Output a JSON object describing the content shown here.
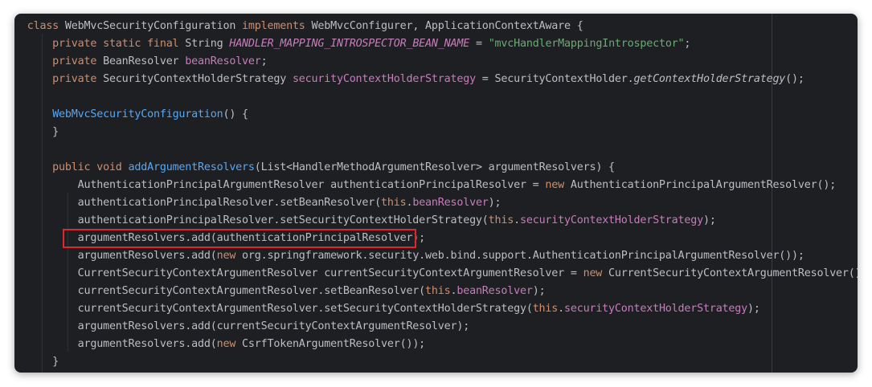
{
  "lines": [
    [
      {
        "t": "class ",
        "c": "kw"
      },
      {
        "t": "WebMvcSecurityConfiguration ",
        "c": "ty"
      },
      {
        "t": "implements ",
        "c": "kw"
      },
      {
        "t": "WebMvcConfigurer, ApplicationContextAware {",
        "c": "ty"
      }
    ],
    [
      {
        "t": "    private static final ",
        "c": "kw"
      },
      {
        "t": "String ",
        "c": "ty"
      },
      {
        "t": "HANDLER_MAPPING_INTROSPECTOR_BEAN_NAME",
        "c": "sfld"
      },
      {
        "t": " = ",
        "c": "ty"
      },
      {
        "t": "\"mvcHandlerMappingIntrospector\"",
        "c": "str"
      },
      {
        "t": ";",
        "c": "ty"
      }
    ],
    [
      {
        "t": "    private ",
        "c": "kw"
      },
      {
        "t": "BeanResolver ",
        "c": "ty"
      },
      {
        "t": "beanResolver",
        "c": "fld"
      },
      {
        "t": ";",
        "c": "ty"
      }
    ],
    [
      {
        "t": "    private ",
        "c": "kw"
      },
      {
        "t": "SecurityContextHolderStrategy ",
        "c": "ty"
      },
      {
        "t": "securityContextHolderStrategy",
        "c": "fld"
      },
      {
        "t": " = SecurityContextHolder.",
        "c": "ty"
      },
      {
        "t": "getContextHolderStrategy",
        "c": "it"
      },
      {
        "t": "();",
        "c": "ty"
      }
    ],
    [],
    [
      {
        "t": "    ",
        "c": "ty"
      },
      {
        "t": "WebMvcSecurityConfiguration",
        "c": "fn"
      },
      {
        "t": "() {",
        "c": "ty"
      }
    ],
    [
      {
        "t": "    }",
        "c": "ty"
      }
    ],
    [],
    [
      {
        "t": "    public void ",
        "c": "kw"
      },
      {
        "t": "addArgumentResolvers",
        "c": "fn"
      },
      {
        "t": "(List<HandlerMethodArgumentResolver> argumentResolvers) {",
        "c": "ty"
      }
    ],
    [
      {
        "t": "        AuthenticationPrincipalArgumentResolver authenticationPrincipalResolver = ",
        "c": "ty"
      },
      {
        "t": "new ",
        "c": "kw"
      },
      {
        "t": "AuthenticationPrincipalArgumentResolver();",
        "c": "ty"
      }
    ],
    [
      {
        "t": "        authenticationPrincipalResolver.setBeanResolver(",
        "c": "ty"
      },
      {
        "t": "this",
        "c": "kw"
      },
      {
        "t": ".",
        "c": "ty"
      },
      {
        "t": "beanResolver",
        "c": "fld"
      },
      {
        "t": ");",
        "c": "ty"
      }
    ],
    [
      {
        "t": "        authenticationPrincipalResolver.setSecurityContextHolderStrategy(",
        "c": "ty"
      },
      {
        "t": "this",
        "c": "kw"
      },
      {
        "t": ".",
        "c": "ty"
      },
      {
        "t": "securityContextHolderStrategy",
        "c": "fld"
      },
      {
        "t": ");",
        "c": "ty"
      }
    ],
    [
      {
        "t": "        argumentResolvers.add(authenticationPrincipalResolver);",
        "c": "ty"
      }
    ],
    [
      {
        "t": "        argumentResolvers.add(",
        "c": "ty"
      },
      {
        "t": "new ",
        "c": "kw"
      },
      {
        "t": "org.springframework.security.web.bind.support.AuthenticationPrincipalArgumentResolver());",
        "c": "ty"
      }
    ],
    [
      {
        "t": "        CurrentSecurityContextArgumentResolver currentSecurityContextArgumentResolver = ",
        "c": "ty"
      },
      {
        "t": "new ",
        "c": "kw"
      },
      {
        "t": "CurrentSecurityContextArgumentResolver();",
        "c": "ty"
      }
    ],
    [
      {
        "t": "        currentSecurityContextArgumentResolver.setBeanResolver(",
        "c": "ty"
      },
      {
        "t": "this",
        "c": "kw"
      },
      {
        "t": ".",
        "c": "ty"
      },
      {
        "t": "beanResolver",
        "c": "fld"
      },
      {
        "t": ");",
        "c": "ty"
      }
    ],
    [
      {
        "t": "        currentSecurityContextArgumentResolver.setSecurityContextHolderStrategy(",
        "c": "ty"
      },
      {
        "t": "this",
        "c": "kw"
      },
      {
        "t": ".",
        "c": "ty"
      },
      {
        "t": "securityContextHolderStrategy",
        "c": "fld"
      },
      {
        "t": ");",
        "c": "ty"
      }
    ],
    [
      {
        "t": "        argumentResolvers.add(currentSecurityContextArgumentResolver);",
        "c": "ty"
      }
    ],
    [
      {
        "t": "        argumentResolvers.add(",
        "c": "ty"
      },
      {
        "t": "new ",
        "c": "kw"
      },
      {
        "t": "CsrfTokenArgumentResolver());",
        "c": "ty"
      }
    ],
    [
      {
        "t": "    }",
        "c": "ty"
      }
    ]
  ],
  "highlighted_line": 12,
  "colors": {
    "editor_background": "#1e1f22",
    "keyword": "#cf8e6d",
    "field": "#c77dbb",
    "string": "#6aab73",
    "method": "#56a8f5",
    "text": "#bcbec4",
    "highlight_box": "#e3262b"
  }
}
